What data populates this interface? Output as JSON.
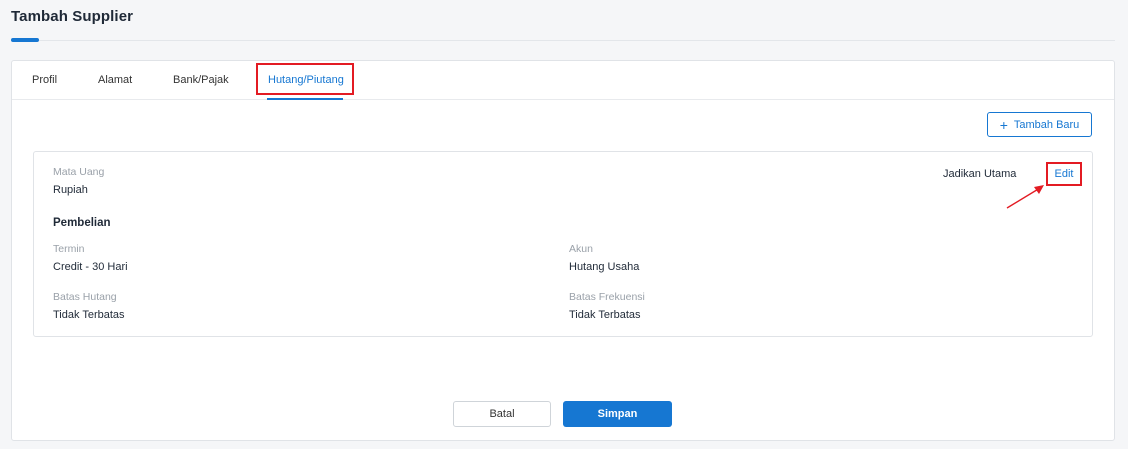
{
  "header": {
    "title": "Tambah Supplier"
  },
  "tabs": [
    {
      "label": "Profil"
    },
    {
      "label": "Alamat"
    },
    {
      "label": "Bank/Pajak"
    },
    {
      "label": "Hutang/Piutang",
      "active": true
    }
  ],
  "toolbar": {
    "add_label": "Tambah Baru",
    "add_icon": "plus-icon"
  },
  "account": {
    "currency_label": "Mata Uang",
    "currency_value": "Rupiah",
    "make_primary": "Jadikan Utama",
    "edit": "Edit",
    "section_title": "Pembelian",
    "term_label": "Termin",
    "term_value": "Credit - 30 Hari",
    "account_label": "Akun",
    "account_value": "Hutang Usaha",
    "debt_limit_label": "Batas Hutang",
    "debt_limit_value": "Tidak Terbatas",
    "frequency_limit_label": "Batas Frekuensi",
    "frequency_limit_value": "Tidak Terbatas"
  },
  "footer": {
    "cancel_label": "Batal",
    "save_label": "Simpan"
  },
  "colors": {
    "accent": "#1677d2",
    "highlight": "#e31b23"
  }
}
